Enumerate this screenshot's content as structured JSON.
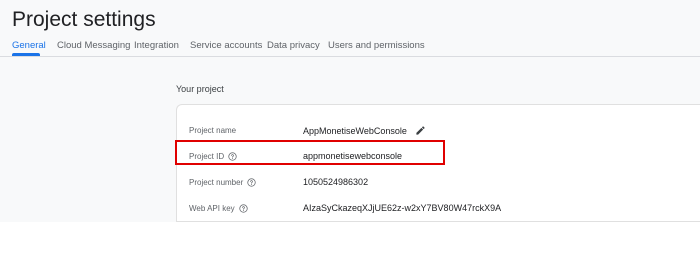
{
  "header": {
    "title": "Project settings",
    "tabs": [
      {
        "label": "General",
        "active": true
      },
      {
        "label": "Cloud Messaging",
        "active": false
      },
      {
        "label": "Integration",
        "active": false
      },
      {
        "label": "Service accounts",
        "active": false
      },
      {
        "label": "Data privacy",
        "active": false
      },
      {
        "label": "Users and permissions",
        "active": false
      }
    ]
  },
  "project": {
    "section_title": "Your project",
    "rows": [
      {
        "label": "Project name",
        "value": "AppMonetiseWebConsole",
        "icon": "edit-icon"
      },
      {
        "label": "Project ID",
        "value": "appmonetisewebconsole",
        "icon": "help-icon"
      },
      {
        "label": "Project number",
        "value": "1050524986302",
        "icon": "help-icon"
      },
      {
        "label": "Web API key",
        "value": "AIzaSyCkazeqXJjUE62z-w2xY7BV80W47rckX9A",
        "icon": "help-icon"
      }
    ]
  },
  "colors": {
    "accent": "#1a73e8",
    "highlight": "#e00000"
  }
}
